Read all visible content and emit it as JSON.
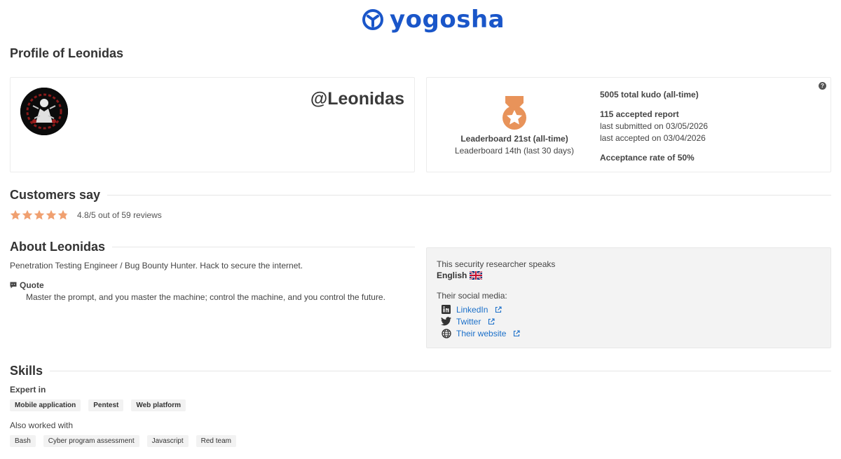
{
  "header": {
    "brand": "yogosha",
    "page_title": "Profile of Leonidas"
  },
  "profile": {
    "handle": "@Leonidas"
  },
  "stats": {
    "leaderboard_all_time": "Leaderboard 21st (all-time)",
    "leaderboard_30_days": "Leaderboard 14th (last 30 days)",
    "total_kudo": "5005 total kudo (all-time)",
    "accepted_reports": "115 accepted report",
    "last_submitted": "last submitted on 03/05/2026",
    "last_accepted": "last accepted on 03/04/2026",
    "acceptance_rate": "Acceptance rate of 50%",
    "help": "?"
  },
  "reviews": {
    "heading": "Customers say",
    "rating": 4.8,
    "stars_total": 5,
    "text": "4.8/5 out of 59 reviews",
    "star_color": "#f0a070"
  },
  "about": {
    "heading": "About Leonidas",
    "bio": "Penetration Testing Engineer / Bug Bounty Hunter. Hack to secure the internet.",
    "quote_label": "Quote",
    "quote": "Master the prompt, and you master the machine; control the machine, and you control the future."
  },
  "languages": {
    "intro": "This security researcher speaks",
    "items": [
      "English"
    ]
  },
  "social": {
    "intro": "Their social media:",
    "links": [
      {
        "label": "LinkedIn",
        "icon": "linkedin-icon"
      },
      {
        "label": "Twitter",
        "icon": "twitter-icon"
      },
      {
        "label": "Their website",
        "icon": "globe-icon"
      }
    ]
  },
  "skills": {
    "heading": "Skills",
    "expert_label": "Expert in",
    "expert": [
      "Mobile application",
      "Pentest",
      "Web platform"
    ],
    "also_label": "Also worked with",
    "also": [
      "Bash",
      "Cyber program assessment",
      "Javascript",
      "Red team"
    ]
  },
  "colors": {
    "brand": "#1a56c9",
    "link": "#1a6fc9",
    "medal": "#e8935a"
  }
}
